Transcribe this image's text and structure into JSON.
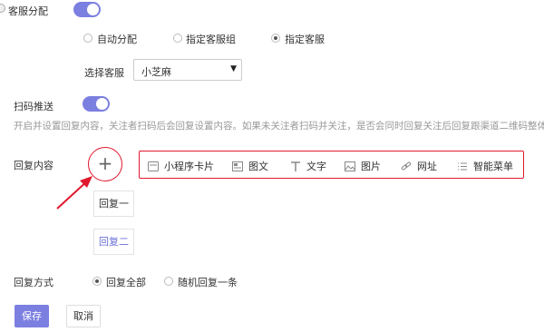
{
  "customer_assign": {
    "label": "客服分配",
    "options": [
      "自动分配",
      "指定客服组",
      "指定客服"
    ],
    "selected": "指定客服",
    "select_label": "选择客服",
    "select_value": "小芝麻"
  },
  "scan_push": {
    "label": "扫码推送",
    "hint": "开启并设置回复内容，关注者扫码后会回复设置内容。如果未关注者扫码并关注，是否会同时回复关注后回复跟渠道二维码整体设置"
  },
  "reply_content": {
    "label": "回复内容",
    "add_symbol": "+",
    "menu": [
      {
        "label": "小程序卡片",
        "icon": "miniprogram-card-icon"
      },
      {
        "label": "图文",
        "icon": "article-icon"
      },
      {
        "label": "文字",
        "icon": "text-icon"
      },
      {
        "label": "图片",
        "icon": "image-icon"
      },
      {
        "label": "网址",
        "icon": "link-icon"
      },
      {
        "label": "智能菜单",
        "icon": "menu-list-icon"
      }
    ],
    "replies": [
      "回复一",
      "回复二"
    ]
  },
  "reply_mode": {
    "label": "回复方式",
    "options": [
      "回复全部",
      "随机回复一条"
    ],
    "selected": "回复全部"
  },
  "actions": {
    "save": "保存",
    "cancel": "取消"
  },
  "colors": {
    "accent": "#7b7fe0",
    "highlight": "#e0182d"
  }
}
